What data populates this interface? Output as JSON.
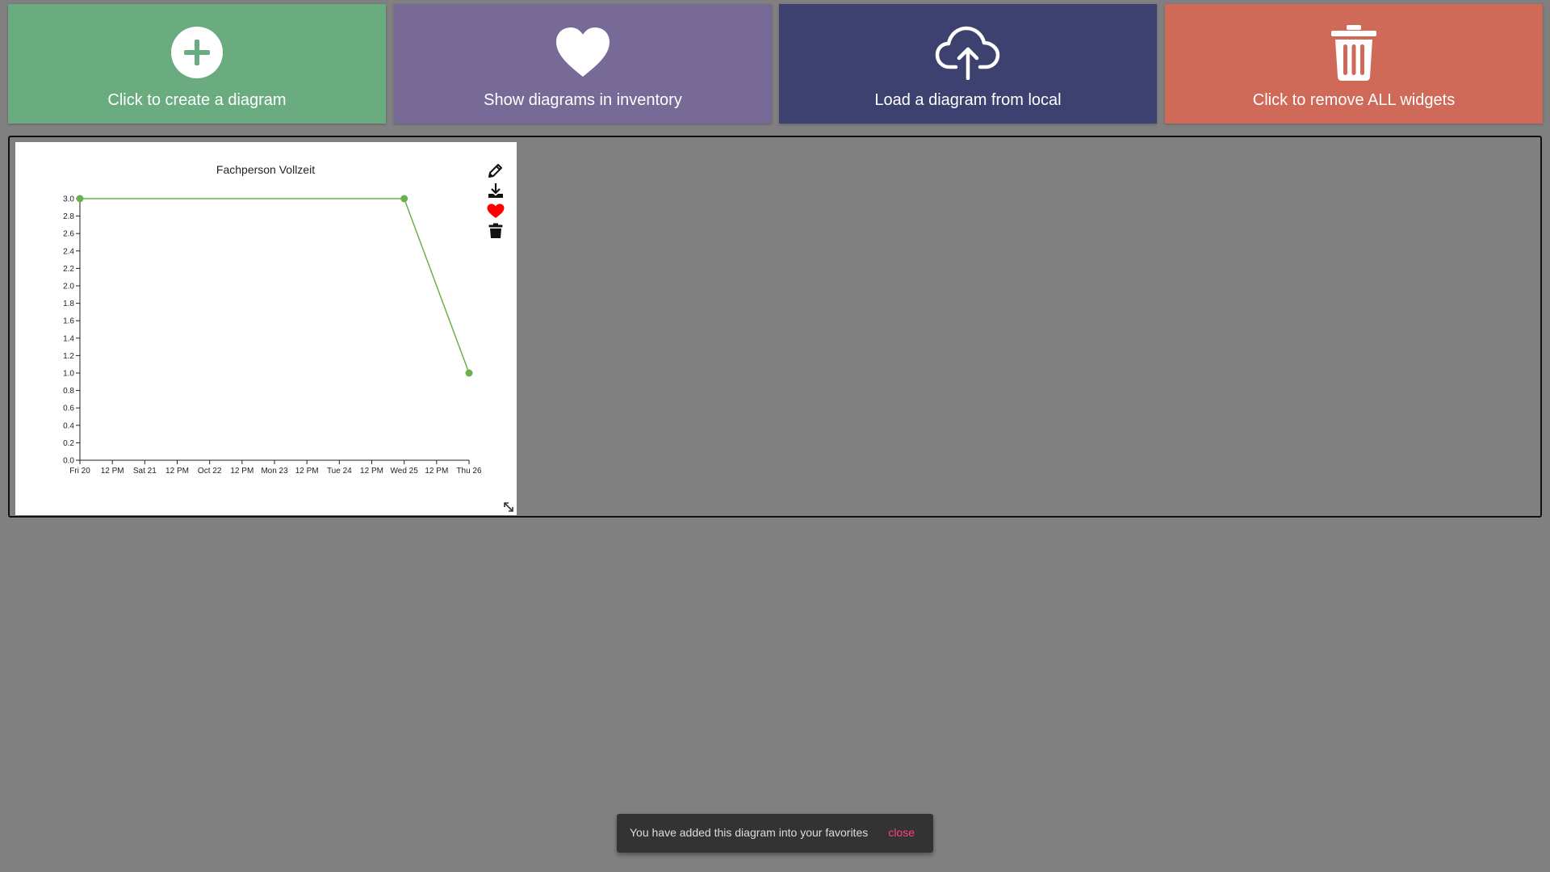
{
  "toolbar": {
    "buttons": [
      {
        "label": "Click to create a diagram",
        "icon": "plus-circle-icon",
        "color": "#6aac80"
      },
      {
        "label": "Show diagrams in inventory",
        "icon": "heart-icon",
        "color": "#776a96"
      },
      {
        "label": "Load a diagram from local",
        "icon": "cloud-upload-icon",
        "color": "#3d4170"
      },
      {
        "label": "Click to remove ALL widgets",
        "icon": "trash-icon",
        "color": "#cf6958"
      }
    ]
  },
  "widget": {
    "title": "Fachperson Vollzeit",
    "tools": [
      "pencil-icon",
      "download-icon",
      "heart-icon",
      "trash-icon"
    ],
    "favorite_color": "#ff0000"
  },
  "chart_data": {
    "type": "line",
    "title": "Fachperson Vollzeit",
    "xlabel": "",
    "ylabel": "",
    "ylim": [
      0,
      3
    ],
    "yticks": [
      0.0,
      0.2,
      0.4,
      0.6,
      0.8,
      1.0,
      1.2,
      1.4,
      1.6,
      1.8,
      2.0,
      2.2,
      2.4,
      2.6,
      2.8,
      3.0
    ],
    "xticks": [
      "Fri 20",
      "12 PM",
      "Sat 21",
      "12 PM",
      "Oct 22",
      "12 PM",
      "Mon 23",
      "12 PM",
      "Tue 24",
      "12 PM",
      "Wed 25",
      "12 PM",
      "Thu 26"
    ],
    "series": [
      {
        "color": "#6ab04c",
        "x": [
          "2017-10-20",
          "2017-10-25",
          "2017-10-26"
        ],
        "values": [
          3.0,
          3.0,
          1.0
        ]
      }
    ]
  },
  "snackbar": {
    "message": "You have added this diagram into your favorites",
    "action": "close"
  }
}
